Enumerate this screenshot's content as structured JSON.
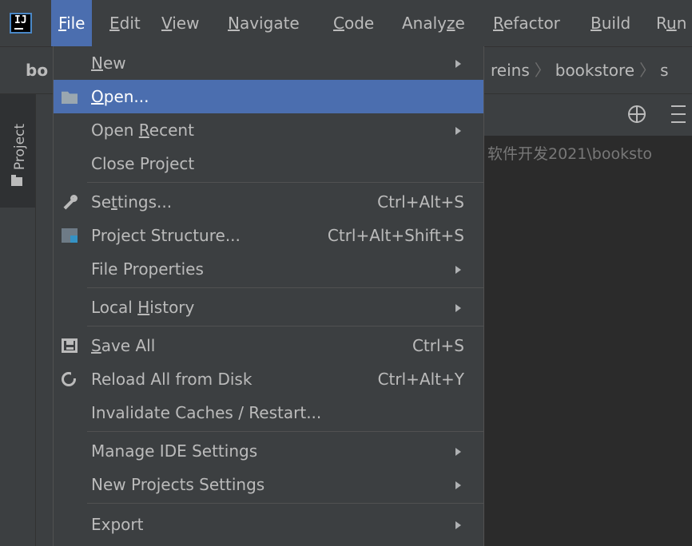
{
  "app": {
    "logo_text": "IJ"
  },
  "menubar": {
    "items": [
      {
        "pre": "",
        "u": "F",
        "post": "ile"
      },
      {
        "pre": "",
        "u": "E",
        "post": "dit"
      },
      {
        "pre": "",
        "u": "V",
        "post": "iew"
      },
      {
        "pre": "",
        "u": "N",
        "post": "avigate"
      },
      {
        "pre": "",
        "u": "C",
        "post": "ode"
      },
      {
        "pre": "Analy",
        "u": "z",
        "post": "e"
      },
      {
        "pre": "",
        "u": "R",
        "post": "efactor"
      },
      {
        "pre": "",
        "u": "B",
        "post": "uild"
      },
      {
        "pre": "R",
        "u": "u",
        "post": "n"
      }
    ]
  },
  "navbar": {
    "project_short": "bo",
    "crumbs": [
      "reins",
      "bookstore",
      "s"
    ]
  },
  "sidebar": {
    "project_tab": "Project"
  },
  "content": {
    "path_text": "软件开发2021\\booksto"
  },
  "file_menu": {
    "new": {
      "pre": "",
      "u": "N",
      "post": "ew"
    },
    "open": {
      "pre": "",
      "u": "O",
      "post": "pen..."
    },
    "open_recent": {
      "pre": "Open ",
      "u": "R",
      "post": "ecent"
    },
    "close_project": {
      "pre": "Close Project",
      "u": "",
      "post": ""
    },
    "settings": {
      "pre": "Se",
      "u": "t",
      "post": "tings..."
    },
    "settings_shortcut": "Ctrl+Alt+S",
    "project_structure": {
      "pre": "Project Structure...",
      "u": "",
      "post": ""
    },
    "project_structure_shortcut": "Ctrl+Alt+Shift+S",
    "file_properties": {
      "pre": "File Properties",
      "u": "",
      "post": ""
    },
    "local_history": {
      "pre": "Local ",
      "u": "H",
      "post": "istory"
    },
    "save_all": {
      "pre": "",
      "u": "S",
      "post": "ave All"
    },
    "save_all_shortcut": "Ctrl+S",
    "reload": {
      "pre": "Reload All from Disk",
      "u": "",
      "post": ""
    },
    "reload_shortcut": "Ctrl+Alt+Y",
    "invalidate": {
      "pre": "Invalidate Caches / Restart...",
      "u": "",
      "post": ""
    },
    "manage_ide": {
      "pre": "Manage IDE Settings",
      "u": "",
      "post": ""
    },
    "new_projects_settings": {
      "pre": "New Projects Settings",
      "u": "",
      "post": ""
    },
    "export": {
      "pre": "Export",
      "u": "",
      "post": ""
    }
  },
  "icons": {
    "open": "folder-open-icon",
    "settings": "wrench-icon",
    "project_structure": "project-structure-icon",
    "save_all": "save-icon",
    "reload": "reload-icon",
    "locate": "locate-icon",
    "expand": "expand-all-icon"
  },
  "colors": {
    "selection": "#4b6eaf",
    "background": "#3c3f41",
    "editor": "#2b2b2b",
    "text": "#bbbbbb"
  }
}
